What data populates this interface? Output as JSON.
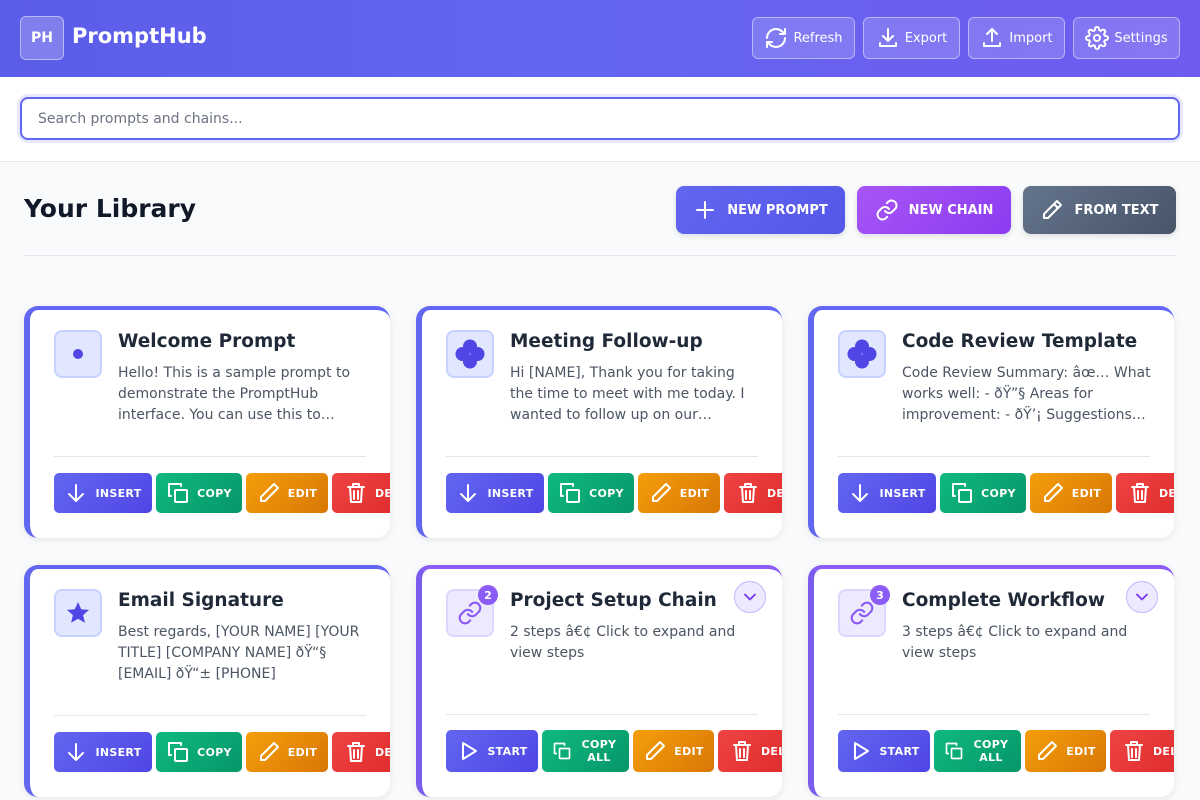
{
  "header": {
    "logo": "PH",
    "brand": "PromptHub",
    "buttons": [
      {
        "label": "Refresh",
        "icon": "refresh-icon"
      },
      {
        "label": "Export",
        "icon": "download-icon"
      },
      {
        "label": "Import",
        "icon": "upload-icon"
      },
      {
        "label": "Settings",
        "icon": "gear-icon"
      }
    ]
  },
  "search": {
    "placeholder": "Search prompts and chains..."
  },
  "library": {
    "title": "Your Library",
    "actions": [
      {
        "label": "NEW PROMPT",
        "icon": "plus-icon",
        "color": "#5b5ef0"
      },
      {
        "label": "NEW CHAIN",
        "icon": "link-icon",
        "color": "#9747f2"
      },
      {
        "label": "FROM TEXT",
        "icon": "pencil-icon",
        "color": "#4b5563"
      }
    ]
  },
  "cards": [
    {
      "type": "prompt",
      "icon": "dot-icon",
      "title": "Welcome Prompt",
      "description": "Hello! This is a sample prompt to demonstrate the PromptHub interface. You can use this to…",
      "buttons": [
        "INSERT",
        "COPY",
        "EDIT",
        "DELETE"
      ]
    },
    {
      "type": "prompt",
      "icon": "flower-icon",
      "title": "Meeting Follow-up",
      "description": "Hi [NAME], Thank you for taking the time to meet with me today. I wanted to follow up on our…",
      "buttons": [
        "INSERT",
        "COPY",
        "EDIT",
        "DELETE"
      ]
    },
    {
      "type": "prompt",
      "icon": "flower-icon",
      "title": "Code Review Template",
      "description": "Code Review Summary: âœ… What works well: - ðŸ”§ Areas for improvement: - ðŸ’¡ Suggestions…",
      "buttons": [
        "INSERT",
        "COPY",
        "EDIT",
        "DELETE"
      ]
    },
    {
      "type": "prompt",
      "icon": "star-icon",
      "title": "Email Signature",
      "description": "Best regards, [YOUR NAME] [YOUR TITLE] [COMPANY NAME] ðŸ“§ [EMAIL] ðŸ“± [PHONE]",
      "buttons": [
        "INSERT",
        "COPY",
        "EDIT",
        "DELETE"
      ]
    },
    {
      "type": "chain",
      "icon": "link-icon",
      "badge": "2",
      "title": "Project Setup Chain",
      "description": "2 steps â€¢ Click to expand and view steps",
      "buttons": [
        "START",
        "COPY ALL",
        "EDIT",
        "DELETE"
      ]
    },
    {
      "type": "chain",
      "icon": "link-icon",
      "badge": "3",
      "title": "Complete Workflow",
      "description": "3 steps â€¢ Click to expand and view steps",
      "buttons": [
        "START",
        "COPY ALL",
        "EDIT",
        "DELETE"
      ]
    }
  ]
}
